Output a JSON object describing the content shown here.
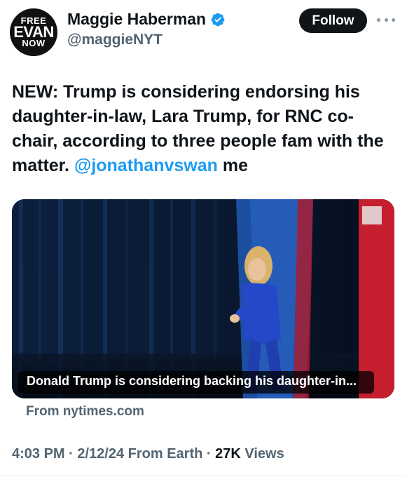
{
  "author": {
    "avatar_lines": [
      "FREE",
      "EVAN",
      "NOW"
    ],
    "display_name": "Maggie Haberman",
    "handle": "@maggieNYT",
    "verified": true
  },
  "header": {
    "follow_label": "Follow",
    "more_icon": "more-horizontal-icon"
  },
  "tweet": {
    "text_before_mention": "NEW: Trump is considering endorsing his daughter-in-law, Lara Trump, for RNC co-chair, according to three people fam with the matter. ",
    "mention": "@jonathanvswan",
    "text_after_mention": " me"
  },
  "link_card": {
    "caption": "Donald Trump is considering backing his daughter-in...",
    "source": "From nytimes.com"
  },
  "meta": {
    "time": "4:03 PM",
    "sep1": " · ",
    "date": "2/12/24",
    "origin": " From Earth",
    "sep2": " · ",
    "views_count": "27K",
    "views_label": " Views"
  },
  "colors": {
    "accent": "#1d9bf0",
    "follow_bg": "#0f1419",
    "secondary_text": "#536471"
  }
}
